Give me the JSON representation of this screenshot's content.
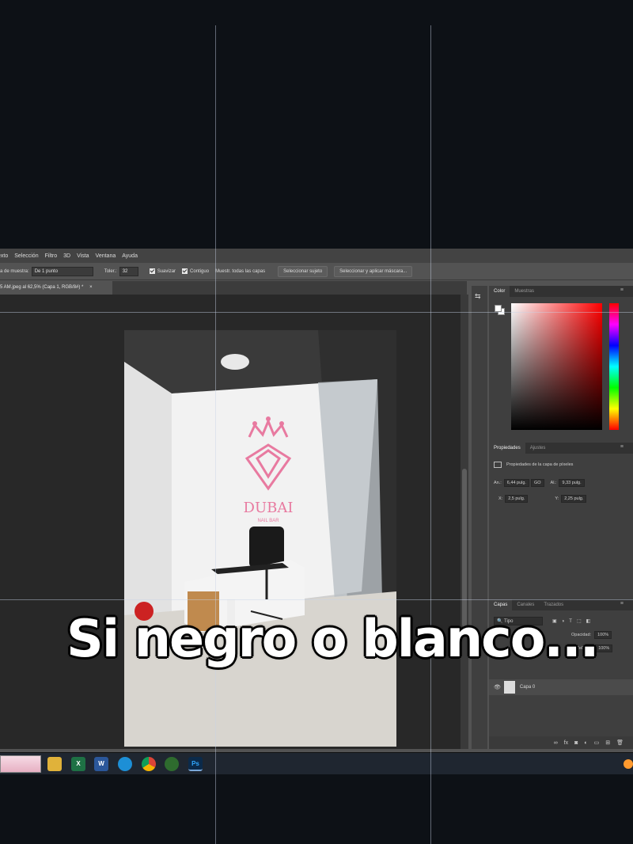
{
  "menu": [
    "exto",
    "Selección",
    "Filtro",
    "3D",
    "Vista",
    "Ventana",
    "Ayuda"
  ],
  "options": {
    "sample_label": "a de muestra:",
    "sample_value": "De 1 punto",
    "tolerance_label": "Toler.:",
    "tolerance_value": "32",
    "smooth_label": "Suavizar",
    "contiguous_label": "Contiguo",
    "sample_all_label": "Muestr. todas las capas",
    "select_subject_button": "Seleccionar sujeto",
    "select_mask_button": "Seleccionar y aplicar máscara..."
  },
  "document_tab": {
    "title": "5 AM.jpeg al 62,5% (Capa 1, RGB/8#) *",
    "close": "×"
  },
  "color_panel": {
    "tabs": [
      "Color",
      "Muestras"
    ]
  },
  "properties_panel": {
    "tabs": [
      "Propiedades",
      "Ajustes"
    ],
    "heading": "Propiedades de la capa de píxeles",
    "an_label": "An.:",
    "an_value": "6,44 pulg.",
    "link_label": "GO",
    "al_label": "Al.:",
    "al_value": "9,33 pulg.",
    "x_label": "X:",
    "x_value": "2,5 pulg.",
    "y_label": "Y:",
    "y_value": "2,25 pulg."
  },
  "layers_panel": {
    "tabs": [
      "Capas",
      "Canales",
      "Trazados"
    ],
    "kind_filter": "Tipo",
    "opacity_label": "Opacidad:",
    "opacity_value": "100%",
    "fill_label": "Relleno:",
    "fill_value": "100%",
    "layer_name": "Capa 0",
    "footer_fx": "fx"
  },
  "photo": {
    "brand_text": "DUBAI",
    "brand_sub": "NAIL BAR",
    "colors": {
      "logo": "#e87aa0"
    }
  },
  "caption": "Si negro o blanco...",
  "colors": {
    "background": "#0d1116",
    "ps_panel": "#535353",
    "accent_orange": "#ff9a2e"
  }
}
